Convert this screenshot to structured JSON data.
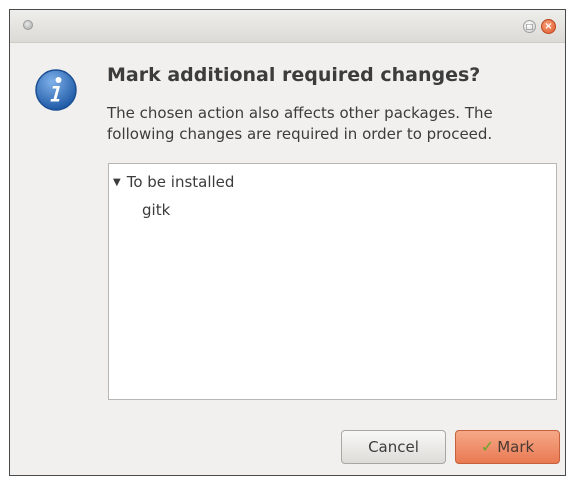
{
  "dialog": {
    "heading": "Mark additional required changes?",
    "description_lines": [
      "The chosen action also affects other packages. The",
      "following changes are required in order to proceed."
    ]
  },
  "titlebar": {
    "maximize_glyph": "□",
    "close_glyph": "×"
  },
  "tree": {
    "group_label": "To be installed",
    "expander_glyph": "▼",
    "items": [
      "gitk"
    ]
  },
  "buttons": {
    "cancel_label": "Cancel",
    "mark_label": "Mark",
    "mark_glyph": "✓"
  },
  "colors": {
    "accent": "#e97a52",
    "info_icon": "#2f6db6"
  },
  "icons": {
    "info": "info-icon",
    "close": "close-icon",
    "maximize": "maximize-icon",
    "check": "check-icon"
  }
}
